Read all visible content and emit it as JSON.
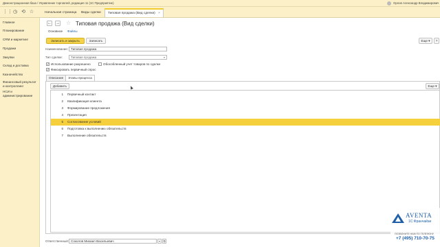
{
  "window": {
    "title": "Демонстрационная база / Управление торговлей, редакция 11  (1С:Предприятие)",
    "user": "Орлов Александр Владимирович"
  },
  "toolbar": {
    "tabs": [
      {
        "label": "Начальная страница"
      },
      {
        "label": "Виды сделки"
      },
      {
        "label": "Типовая продажа (Вид сделки)",
        "close": "×"
      }
    ]
  },
  "sidebar": {
    "items": [
      {
        "label": "Главное"
      },
      {
        "label": "Планирование"
      },
      {
        "label": "CRM и маркетинг"
      },
      {
        "label": "Продажи"
      },
      {
        "label": "Закупки"
      },
      {
        "label": "Склад и доставка"
      },
      {
        "label": "Казначейство"
      },
      {
        "label": "Финансовый результат и контроллинг"
      },
      {
        "label": "НСИ и администрирование"
      }
    ]
  },
  "form": {
    "title": "Типовая продажа (Вид сделки)",
    "links": {
      "main": "Основное",
      "files": "Файлы"
    },
    "buttons": {
      "save_close": "Записать и закрыть",
      "save": "Записать",
      "more": "Еще ▾",
      "help": "?"
    },
    "name_label": "Наименование:",
    "name_value": "Типовая продажа",
    "type_label": "Тип сделки:",
    "type_value": "Типовая продажа",
    "checkboxes": {
      "allowed": "Использование разрешено",
      "separate_goods": "Обособленный учет товаров по сделке",
      "primary_demand": "Фиксировать первичный спрос"
    },
    "tabs": {
      "description": "Описание",
      "stages": "Этапы процесса"
    },
    "table": {
      "add_button": "Добавить",
      "more": "Еще ▾",
      "rows": [
        {
          "num": "1",
          "name": "Первичный контакт"
        },
        {
          "num": "2",
          "name": "Квалификация клиента"
        },
        {
          "num": "3",
          "name": "Формирование предложения"
        },
        {
          "num": "4",
          "name": "Презентация"
        },
        {
          "num": "5",
          "name": "Согласование условий"
        },
        {
          "num": "6",
          "name": "Подготовка к выполнению обязательств"
        },
        {
          "num": "7",
          "name": "Выполнение обязательств"
        }
      ]
    },
    "responsible_label": "Ответственный:",
    "responsible_value": "Соколов Михаил Васильевич"
  },
  "watermark": {
    "brand": "AVENTA",
    "sub": "1С:Франчайзи",
    "call": "ПОЗВОНИТЕ НАМ ПО ТЕЛЕФОНУ",
    "phone": "+7 (495) 710-70-75"
  },
  "colors": {
    "accent": "#f4d34a",
    "selected_row": "#f6cf3c",
    "panel_bg": "#fbf0c8",
    "link": "#1b5fa8",
    "brand": "#1f5fa8"
  }
}
